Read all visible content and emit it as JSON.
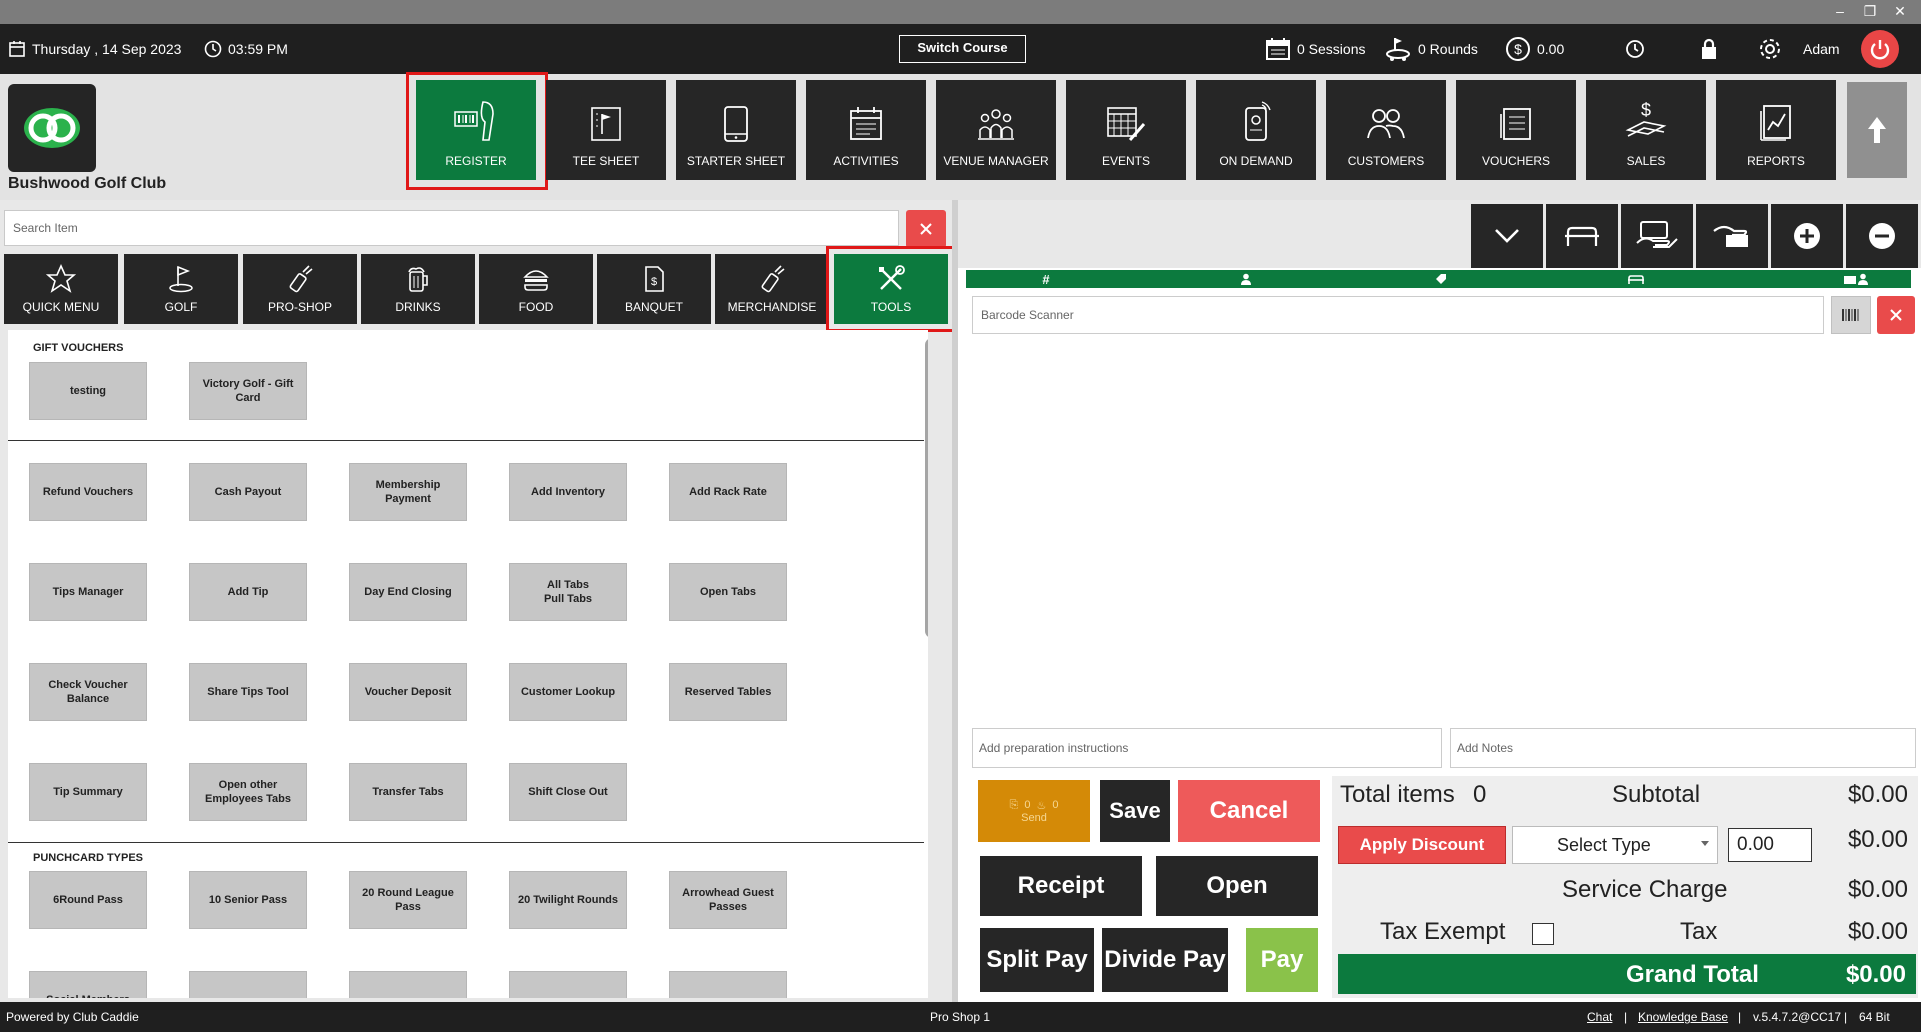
{
  "topbar": {
    "date": "Thursday ,  14 Sep 2023",
    "time": "03:59 PM",
    "switch_course": "Switch Course",
    "sessions": "0 Sessions",
    "rounds": "0 Rounds",
    "cash": "0.00",
    "user": "Adam"
  },
  "club": {
    "name": "Bushwood Golf Club"
  },
  "nav": {
    "register": "REGISTER",
    "tee_sheet": "TEE SHEET",
    "starter_sheet": "STARTER SHEET",
    "activities": "ACTIVITIES",
    "venue_manager": "VENUE MANAGER",
    "events": "EVENTS",
    "on_demand": "ON DEMAND",
    "customers": "CUSTOMERS",
    "vouchers": "VOUCHERS",
    "sales": "SALES",
    "reports": "REPORTS"
  },
  "search": {
    "placeholder": "Search Item"
  },
  "categories": {
    "quick_menu": "QUICK MENU",
    "golf": "GOLF",
    "pro_shop": "PRO-SHOP",
    "drinks": "DRINKS",
    "food": "FOOD",
    "banquet": "BANQUET",
    "merchandise": "MERCHANDISE",
    "tools": "TOOLS"
  },
  "sections": {
    "gift_vouchers": "GIFT VOUCHERS",
    "punchcard_types": "PUNCHCARD TYPES"
  },
  "gift_vouchers": [
    "testing",
    "Victory Golf - Gift\nCard"
  ],
  "tools": [
    [
      "Refund Vouchers",
      "Cash Payout",
      "Membership\nPayment",
      "Add Inventory",
      "Add Rack Rate"
    ],
    [
      "Tips Manager",
      "Add Tip",
      "Day End Closing",
      "All Tabs\nPull Tabs",
      "Open Tabs"
    ],
    [
      "Check Voucher\nBalance",
      "Share Tips Tool",
      "Voucher Deposit",
      "Customer Lookup",
      "Reserved Tables"
    ],
    [
      "Tip Summary",
      "Open other\nEmployees Tabs",
      "Transfer Tabs",
      "Shift Close Out"
    ]
  ],
  "punchcards": [
    [
      "6Round Pass",
      "10 Senior Pass",
      "20 Round League\nPass",
      "20 Twilight Rounds",
      "Arrowhead Guest\nPasses"
    ],
    [
      "Social Members",
      "",
      "",
      "",
      ""
    ]
  ],
  "order": {
    "barcode_placeholder": "Barcode Scanner",
    "prep_placeholder": "Add preparation instructions",
    "notes_placeholder": "Add Notes",
    "send_count_a": "0",
    "send_count_b": "0",
    "send_label": "Send",
    "save": "Save",
    "cancel": "Cancel",
    "receipt": "Receipt",
    "open": "Open",
    "split_pay": "Split Pay",
    "divide_pay": "Divide Pay",
    "pay": "Pay"
  },
  "totals": {
    "total_items_label": "Total items",
    "total_items": "0",
    "subtotal_label": "Subtotal",
    "subtotal": "$0.00",
    "apply_discount": "Apply Discount",
    "select_type": "Select Type",
    "discount_value": "0.00",
    "discount_amount": "$0.00",
    "service_charge_label": "Service Charge",
    "service_charge": "$0.00",
    "tax_exempt_label": "Tax Exempt",
    "tax_label": "Tax",
    "tax": "$0.00",
    "grand_total_label": "Grand Total",
    "grand_total": "$0.00"
  },
  "footer": {
    "powered_by": "Powered by Club Caddie",
    "station": "Pro Shop 1",
    "chat": "Chat",
    "sep1": "|",
    "kb": "Knowledge Base",
    "sep2": "|",
    "version": "v.5.4.7.2@CC17",
    "sep3": "|",
    "bits": "64 Bit"
  },
  "colors": {
    "accent": "#0c7a3e",
    "danger": "#e94b4b",
    "dark": "#262626",
    "highlight": "#e01818",
    "send": "#d48a07",
    "pay": "#8ac24a"
  }
}
